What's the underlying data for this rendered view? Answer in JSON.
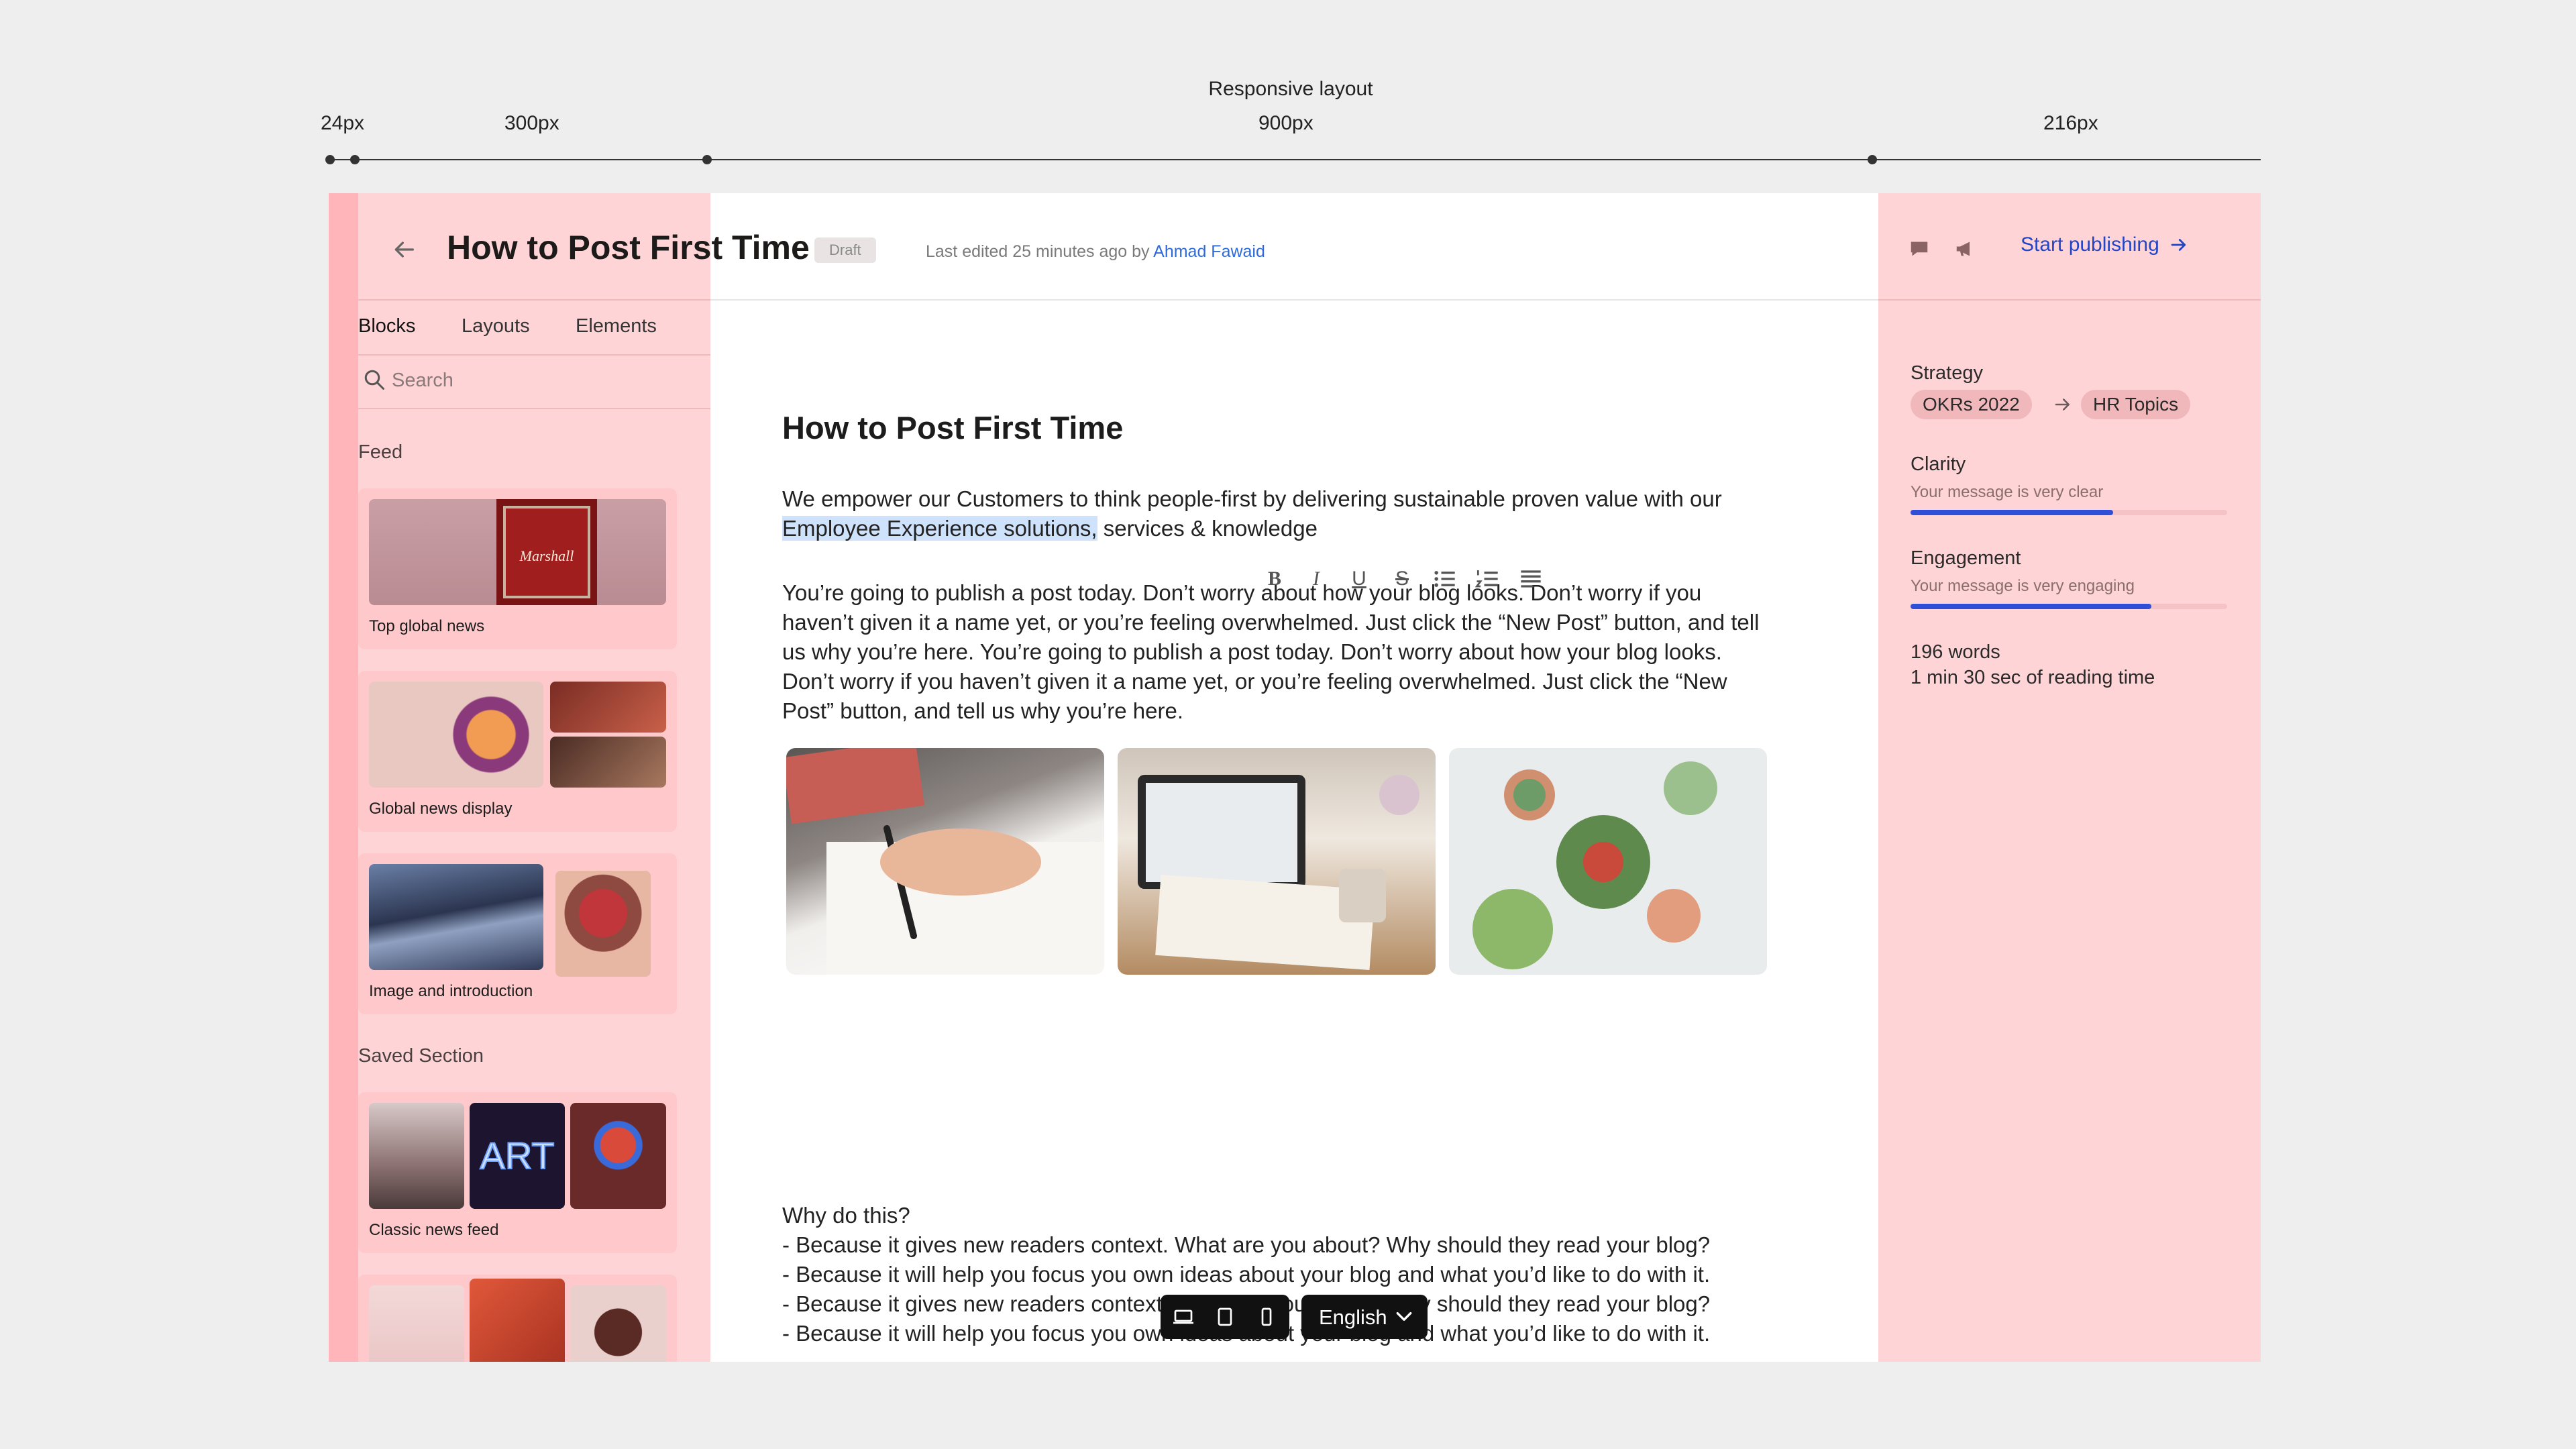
{
  "annotation": {
    "title": "Responsive layout",
    "labels": [
      "24px",
      "300px",
      "900px",
      "216px"
    ]
  },
  "header": {
    "title": "How to Post First Time",
    "status_badge": "Draft",
    "meta_prefix": "Last edited 25 minutes ago by",
    "author": "Ahmad Fawaid"
  },
  "sidebar": {
    "tabs": [
      "Blocks",
      "Layouts",
      "Elements"
    ],
    "search_placeholder": "Search",
    "sections": [
      {
        "label": "Feed",
        "cards": [
          {
            "caption": "Top global news"
          },
          {
            "caption": "Global news display"
          },
          {
            "caption": "Image and introduction"
          }
        ]
      },
      {
        "label": "Saved Section",
        "cards": [
          {
            "caption": "Classic news feed"
          }
        ]
      }
    ]
  },
  "document": {
    "title": "How to Post First Time",
    "intro_before": "We empower our Customers to think people-first by delivering sustainable proven value with our",
    "intro_highlight": "Employee Experience solutions,",
    "intro_after": " services & knowledge",
    "body_paragraph": "You’re going to publish a post today. Don’t worry about how your blog looks. Don’t worry if you haven’t given it a name yet, or you’re feeling overwhelmed. Just click the “New Post” button, and tell us why you’re here. You’re going to publish a post today. Don’t worry about how your blog looks. Don’t worry if you haven’t given it a name yet, or you’re feeling overwhelmed. Just click the “New Post” button, and tell us why you’re here.",
    "why_heading": "Why do this?",
    "why_items": [
      "- Because it gives new readers context. What are you about? Why should they read your blog?",
      "- Because it will help you focus you own ideas about your blog and what you’d like to do with it.",
      "- Because it gives new readers context. What are you about? Why should they read your blog?",
      "- Because it will help you focus you own ideas about your blog and what you’d like to do with it."
    ],
    "images": [
      "writing-notebook",
      "laptop-desk",
      "succulents"
    ]
  },
  "format_toolbar": [
    "bold-icon",
    "italic-icon",
    "underline-icon",
    "strikethrough-icon",
    "bullet-list-icon",
    "numbered-list-icon",
    "align-icon"
  ],
  "right_panel": {
    "publish_label": "Start publishing",
    "strategy_label": "Strategy",
    "strategy_chips": [
      "OKRs 2022",
      "HR Topics"
    ],
    "clarity_label": "Clarity",
    "clarity_message": "Your message is very clear",
    "clarity_level": 0.64,
    "engagement_label": "Engagement",
    "engagement_message": "Your message is very engaging",
    "engagement_level": 0.76,
    "word_count": "196 words",
    "reading_time": "1 min 30 sec of reading time"
  },
  "bottom_bar": {
    "devices": [
      "desktop-icon",
      "tablet-icon",
      "mobile-icon"
    ],
    "language": "English"
  },
  "colors": {
    "accent": "#2f4fd6",
    "link": "#2f6bd8",
    "sidebar_bg": "#ffd4d6",
    "highlight": "#cfe2fb"
  }
}
